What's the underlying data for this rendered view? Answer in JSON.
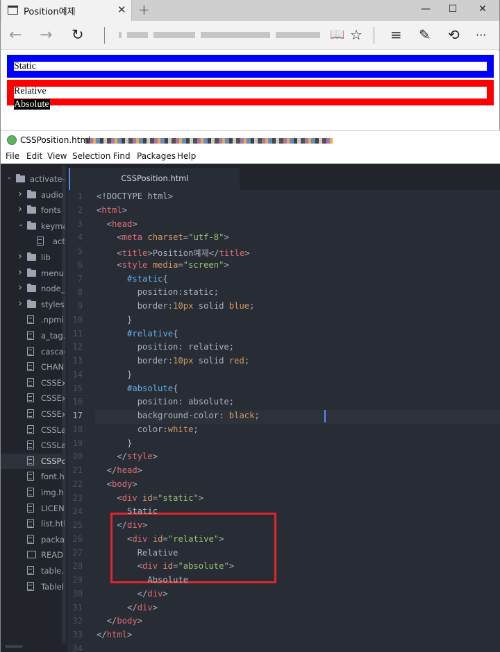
{
  "browser": {
    "tab_title": "Position예제",
    "tab_close": "✕",
    "new_tab": "+",
    "window_controls": {
      "minimize": "—",
      "maximize": "☐",
      "close": "✕"
    },
    "nav": {
      "back": "←",
      "forward": "→",
      "refresh": "↻"
    },
    "toolbar_icons": [
      "reading-view-icon",
      "favorite-star-icon",
      "hub-icon",
      "web-note-icon",
      "share-icon",
      "more-icon"
    ],
    "toolbar_glyphs": {
      "reading": "📖",
      "star": "☆",
      "hub": "≡",
      "note": "✎",
      "share": "⟲",
      "more": "···"
    },
    "page": {
      "static_text": "Static",
      "relative_text": "Relative",
      "absolute_text": "Absolute"
    },
    "colors": {
      "static_border": "#0000ff",
      "relative_border": "#ff0000",
      "absolute_bg": "#000000"
    }
  },
  "editor": {
    "window_title": "CSSPosition.html",
    "menu": [
      "File",
      "Edit",
      "View",
      "Selection",
      "Find",
      "Packages",
      "Help"
    ],
    "tab_label": "CSSPosition.html",
    "tree": [
      {
        "kind": "root",
        "label": "activate-p",
        "icon": "folder"
      },
      {
        "kind": "folder",
        "label": "audio",
        "icon": "folder"
      },
      {
        "kind": "folder",
        "label": "fonts",
        "icon": "folder"
      },
      {
        "kind": "folder-open",
        "label": "keyma",
        "icon": "folder"
      },
      {
        "kind": "file-nested",
        "label": "act",
        "icon": "file"
      },
      {
        "kind": "folder",
        "label": "lib",
        "icon": "folder"
      },
      {
        "kind": "folder",
        "label": "menu",
        "icon": "folder"
      },
      {
        "kind": "folder",
        "label": "node_",
        "icon": "folder"
      },
      {
        "kind": "folder",
        "label": "styles",
        "icon": "folder"
      },
      {
        "kind": "file",
        "label": ".npmi",
        "icon": "file"
      },
      {
        "kind": "file",
        "label": "a_tag.",
        "icon": "file"
      },
      {
        "kind": "file",
        "label": "cascac",
        "icon": "file"
      },
      {
        "kind": "file",
        "label": "CHAN",
        "icon": "file"
      },
      {
        "kind": "file",
        "label": "CSSEx",
        "icon": "file"
      },
      {
        "kind": "file",
        "label": "CSSEx",
        "icon": "file"
      },
      {
        "kind": "file",
        "label": "CSSEx",
        "icon": "file"
      },
      {
        "kind": "file",
        "label": "CSSLa",
        "icon": "file"
      },
      {
        "kind": "file",
        "label": "CSSLa",
        "icon": "file"
      },
      {
        "kind": "file-selected",
        "label": "CSSPc",
        "icon": "file"
      },
      {
        "kind": "file",
        "label": "font.h",
        "icon": "file"
      },
      {
        "kind": "file",
        "label": "img.h",
        "icon": "file"
      },
      {
        "kind": "file",
        "label": "LICEN",
        "icon": "file"
      },
      {
        "kind": "file",
        "label": "list.htl",
        "icon": "file"
      },
      {
        "kind": "file",
        "label": "packa",
        "icon": "file"
      },
      {
        "kind": "book",
        "label": "READ",
        "icon": "book"
      },
      {
        "kind": "file",
        "label": "table.",
        "icon": "file"
      },
      {
        "kind": "file",
        "label": "Tablel",
        "icon": "file"
      }
    ],
    "active_line": 17,
    "line_numbers": [
      "1",
      "2",
      "3",
      "4",
      "5",
      "6",
      "7",
      "8",
      "9",
      "10",
      "11",
      "12",
      "13",
      "14",
      "15",
      "16",
      "17",
      "18",
      "19",
      "20",
      "21",
      "22",
      "23",
      "24",
      "25",
      "26",
      "27",
      "28",
      "29",
      "30",
      "31",
      "32",
      "33",
      "34"
    ],
    "code_lines": [
      [
        [
          "p",
          "<!DOCTYPE html>"
        ]
      ],
      [
        [
          "p",
          "<"
        ],
        [
          "tag",
          "html"
        ],
        [
          "p",
          ">"
        ]
      ],
      [
        [
          "p",
          "  <"
        ],
        [
          "tag",
          "head"
        ],
        [
          "p",
          ">"
        ]
      ],
      [
        [
          "p",
          "    <"
        ],
        [
          "tag",
          "meta"
        ],
        [
          "p",
          " "
        ],
        [
          "attr",
          "charset"
        ],
        [
          "p",
          "="
        ],
        [
          "str",
          "\"utf-8\""
        ],
        [
          "p",
          ">"
        ]
      ],
      [
        [
          "p",
          "    <"
        ],
        [
          "tag",
          "title"
        ],
        [
          "p",
          ">Position예제</"
        ],
        [
          "tag",
          "title"
        ],
        [
          "p",
          ">"
        ]
      ],
      [
        [
          "p",
          "    <"
        ],
        [
          "tag",
          "style"
        ],
        [
          "p",
          " "
        ],
        [
          "attr",
          "media"
        ],
        [
          "p",
          "="
        ],
        [
          "str",
          "\"screen\""
        ],
        [
          "p",
          ">"
        ]
      ],
      [
        [
          "p",
          "      "
        ],
        [
          "sel",
          "#static"
        ],
        [
          "p",
          "{"
        ]
      ],
      [
        [
          "p",
          "        position:static;"
        ]
      ],
      [
        [
          "p",
          "        border:"
        ],
        [
          "num",
          "10px"
        ],
        [
          "p",
          " solid "
        ],
        [
          "kw",
          "blue"
        ],
        [
          "p",
          ";"
        ]
      ],
      [
        [
          "p",
          "      }"
        ]
      ],
      [
        [
          "p",
          "      "
        ],
        [
          "sel",
          "#relative"
        ],
        [
          "p",
          "{"
        ]
      ],
      [
        [
          "p",
          "        position: relative;"
        ]
      ],
      [
        [
          "p",
          "        border:"
        ],
        [
          "num",
          "10px"
        ],
        [
          "p",
          " solid "
        ],
        [
          "kw",
          "red"
        ],
        [
          "p",
          ";"
        ]
      ],
      [
        [
          "p",
          "      }"
        ]
      ],
      [
        [
          "p",
          "      "
        ],
        [
          "sel",
          "#absolute"
        ],
        [
          "p",
          "{"
        ]
      ],
      [
        [
          "p",
          "        position: absolute;"
        ]
      ],
      [
        [
          "p",
          "        background-color: "
        ],
        [
          "kw",
          "black"
        ],
        [
          "p",
          ";"
        ]
      ],
      [
        [
          "p",
          "        color:"
        ],
        [
          "kw",
          "white"
        ],
        [
          "p",
          ";"
        ]
      ],
      [
        [
          "p",
          "      }"
        ]
      ],
      [
        [
          "p",
          "    </"
        ],
        [
          "tag",
          "style"
        ],
        [
          "p",
          ">"
        ]
      ],
      [
        [
          "p",
          "  </"
        ],
        [
          "tag",
          "head"
        ],
        [
          "p",
          ">"
        ]
      ],
      [
        [
          "p",
          "  <"
        ],
        [
          "tag",
          "body"
        ],
        [
          "p",
          ">"
        ]
      ],
      [
        [
          "p",
          "    <"
        ],
        [
          "tag",
          "div"
        ],
        [
          "p",
          " "
        ],
        [
          "attr",
          "id"
        ],
        [
          "p",
          "="
        ],
        [
          "str",
          "\"static\""
        ],
        [
          "p",
          ">"
        ]
      ],
      [
        [
          "p",
          "      Static"
        ]
      ],
      [
        [
          "p",
          "    </"
        ],
        [
          "tag",
          "div"
        ],
        [
          "p",
          ">"
        ]
      ],
      [
        [
          "p",
          "      <"
        ],
        [
          "tag",
          "div"
        ],
        [
          "p",
          " "
        ],
        [
          "attr",
          "id"
        ],
        [
          "p",
          "="
        ],
        [
          "str",
          "\"relative\""
        ],
        [
          "p",
          ">"
        ]
      ],
      [
        [
          "p",
          "        Relative"
        ]
      ],
      [
        [
          "p",
          "        <"
        ],
        [
          "tag",
          "div"
        ],
        [
          "p",
          " "
        ],
        [
          "attr",
          "id"
        ],
        [
          "p",
          "="
        ],
        [
          "str",
          "\"absolute\""
        ],
        [
          "p",
          ">"
        ]
      ],
      [
        [
          "p",
          "          Absolute"
        ]
      ],
      [
        [
          "p",
          "        </"
        ],
        [
          "tag",
          "div"
        ],
        [
          "p",
          ">"
        ]
      ],
      [
        [
          "p",
          "      </"
        ],
        [
          "tag",
          "div"
        ],
        [
          "p",
          ">"
        ]
      ],
      [
        [
          "p",
          "  </"
        ],
        [
          "tag",
          "body"
        ],
        [
          "p",
          ">"
        ]
      ],
      [
        [
          "p",
          "</"
        ],
        [
          "tag",
          "html"
        ],
        [
          "p",
          ">"
        ]
      ],
      [
        [
          "p",
          ""
        ]
      ]
    ],
    "colors": {
      "bg": "#282c34",
      "sidebar": "#21252b",
      "tag": "#e06c75",
      "attr": "#d19a66",
      "string": "#98c379",
      "selector": "#61afef",
      "highlight_box": "#e0252b"
    }
  }
}
